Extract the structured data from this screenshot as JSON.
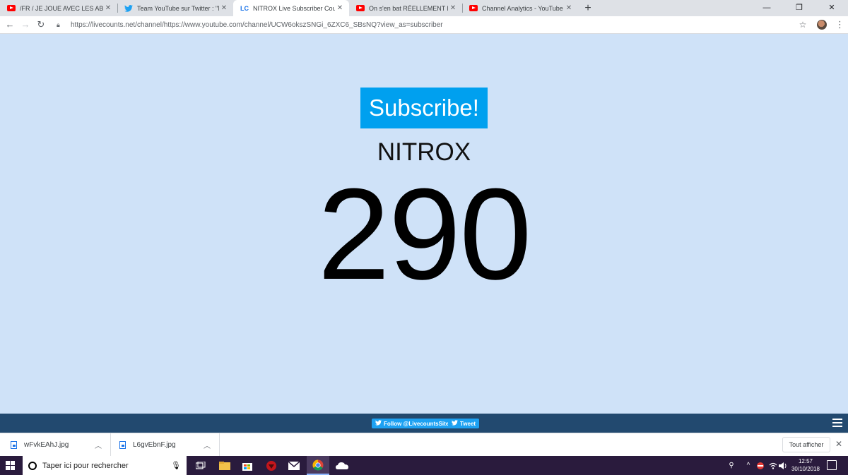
{
  "browser": {
    "tabs": [
      {
        "title": "/FR / JE JOUE AVEC LES ABO EN L",
        "favicon": "youtube-icon",
        "active": false
      },
      {
        "title": "Team YouTube sur Twitter : \"Nou",
        "favicon": "twitter-icon",
        "active": false
      },
      {
        "title": "NITROX Live Subscriber Count - L",
        "favicon": "LC",
        "active": true
      },
      {
        "title": "On s'en bat RÉELLEMENT les cou",
        "favicon": "youtube-icon",
        "active": false
      },
      {
        "title": "Channel Analytics - YouTube Stu",
        "favicon": "youtube-icon",
        "active": false
      }
    ],
    "new_tab_label": "+",
    "window_controls": {
      "minimize": "—",
      "restore": "❐",
      "close": "✕"
    },
    "url": "https://livecounts.net/channel/https://www.youtube.com/channel/UCW6okszSNGi_6ZXC6_SBsNQ?view_as=subscriber"
  },
  "page": {
    "subscribe_label": "Subscribe!",
    "channel_name": "NITROX",
    "subscriber_count": "290",
    "colors": {
      "background": "#cfe2f8",
      "subscribe": "#00a0ef",
      "footer": "#22496f"
    }
  },
  "footer": {
    "follow_label": "Follow @LivecountsSite",
    "tweet_label": "Tweet"
  },
  "downloads": {
    "items": [
      {
        "name": "wFvkEAhJ.jpg"
      },
      {
        "name": "L6gvEbnF.jpg"
      }
    ],
    "show_all_label": "Tout afficher"
  },
  "taskbar": {
    "search_placeholder": "Taper ici pour rechercher",
    "time": "12:57",
    "date": "30/10/2018"
  }
}
